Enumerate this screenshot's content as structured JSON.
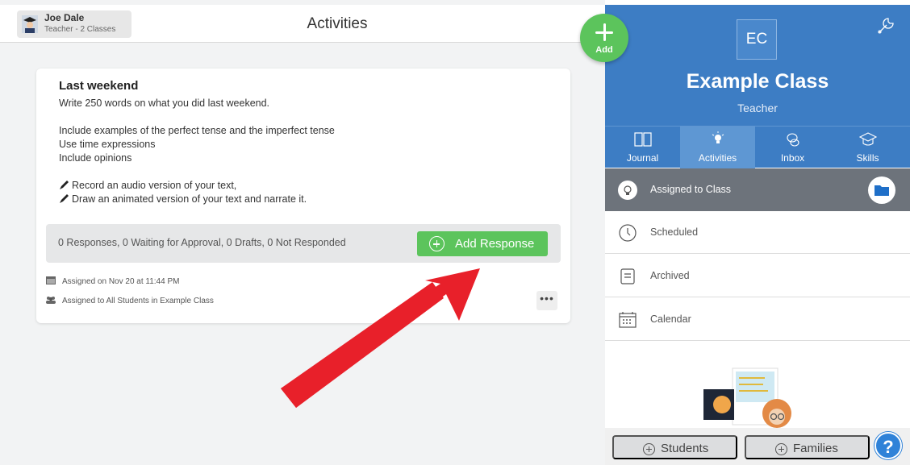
{
  "user": {
    "name": "Joe Dale",
    "role": "Teacher - 2 Classes"
  },
  "page": {
    "title": "Activities"
  },
  "activity": {
    "title": "Last weekend",
    "lines": [
      "Write 250 words on what you did last weekend.",
      "Include examples of the perfect tense and the imperfect tense",
      "Use time expressions",
      "Include opinions",
      "Record an audio version of your text,",
      "Draw an animated version of your text and narrate it."
    ],
    "responses_summary": "0 Responses, 0 Waiting for Approval, 0 Drafts, 0 Not Responded",
    "add_response_label": "Add Response",
    "assigned_on": "Assigned on Nov 20 at 11:44 PM",
    "assigned_to": "Assigned to All Students in Example Class",
    "more_label": "•••"
  },
  "fab": {
    "label": "Add"
  },
  "class": {
    "initials": "EC",
    "name": "Example Class",
    "role": "Teacher"
  },
  "tabs": [
    {
      "label": "Journal",
      "icon": "book-icon",
      "active": false
    },
    {
      "label": "Activities",
      "icon": "lightbulb-icon",
      "active": true
    },
    {
      "label": "Inbox",
      "icon": "chat-bubbles-icon",
      "active": false
    },
    {
      "label": "Skills",
      "icon": "graduation-cap-icon",
      "active": false
    }
  ],
  "menu": [
    {
      "label": "Assigned to Class",
      "icon": "lightbulb-icon",
      "active": true
    },
    {
      "label": "Scheduled",
      "icon": "clock-icon",
      "active": false
    },
    {
      "label": "Archived",
      "icon": "archive-icon",
      "active": false
    },
    {
      "label": "Calendar",
      "icon": "calendar-icon",
      "active": false
    }
  ],
  "footer": {
    "students_label": "Students",
    "families_label": "Families",
    "help_label": "?"
  },
  "colors": {
    "header_blue": "#3d7dc4",
    "active_tab": "#5e97d3",
    "green": "#5cc45c",
    "red_arrow": "#e8202a",
    "active_menu": "#6d737b"
  }
}
